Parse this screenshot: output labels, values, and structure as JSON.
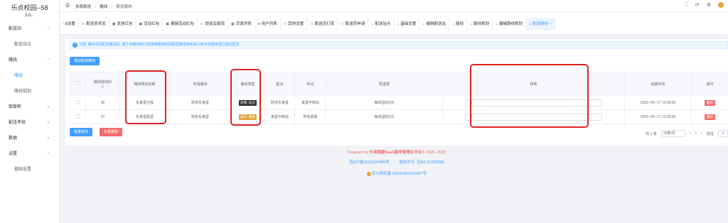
{
  "app": {
    "title": "乐点校园--58",
    "subtitle": "多段..."
  },
  "sidebar": {
    "items": [
      {
        "label": "配送站",
        "arrow": "^"
      },
      {
        "label": "配送站点"
      },
      {
        "label": "路线",
        "arrow": "^"
      },
      {
        "label": "路线"
      },
      {
        "label": "路线规划"
      },
      {
        "label": "取餐柜",
        "arrow": "v"
      },
      {
        "label": "配送考核",
        "arrow": "v"
      },
      {
        "label": "数据",
        "arrow": "v"
      },
      {
        "label": "设置",
        "arrow": "^"
      },
      {
        "label": "基础设置"
      }
    ]
  },
  "topbar": {
    "fold_icon": "☰",
    "breadcrumb": [
      "多段配送",
      "路线",
      "配送路线"
    ],
    "sep": ">"
  },
  "tabs": [
    {
      "label": "8设置",
      "icon": "‹"
    },
    {
      "label": "配送员奖惩",
      "icon": "⚇"
    },
    {
      "label": "发放红包",
      "icon": "▣"
    },
    {
      "label": "活动红包",
      "icon": "▣"
    },
    {
      "label": "编辑活动红包",
      "icon": "▣"
    },
    {
      "label": "提成及提现",
      "icon": "⚇"
    },
    {
      "label": "页面列表",
      "icon": "▦"
    },
    {
      "label": "用户列表",
      "icon": "●"
    },
    {
      "label": "其他设置",
      "icon": "⚇"
    },
    {
      "label": "配送员打赏",
      "icon": "⚇"
    },
    {
      "label": "配送员申请",
      "icon": "⚇"
    },
    {
      "label": "配送站点",
      "icon": "⌂"
    },
    {
      "label": "基础设置",
      "icon": "⌂"
    },
    {
      "label": "编辑配送站",
      "icon": "⌂"
    },
    {
      "label": "路线",
      "icon": "⌂"
    },
    {
      "label": "路线规划",
      "icon": "⌂"
    },
    {
      "label": "编辑路线规划",
      "icon": "⌂"
    },
    {
      "label": "配送路线",
      "icon": "⌂",
      "active": true,
      "close": "×"
    }
  ],
  "notice": {
    "icon": "i",
    "text": "注意: 路线添加配送路线后, 属于该路线的订单将按照绑定的配送路线排序由小到大的顺序进行送达配送"
  },
  "buttons": {
    "add": "添加配送路线",
    "batch_edit": "批量修改",
    "batch_delete": "批量删除"
  },
  "table": {
    "headers": [
      "",
      "路线规划ID",
      "路线规划名称",
      "所属路线",
      "路线类型",
      "起点",
      "终点",
      "配送费",
      "排序",
      "创建时间",
      "操作"
    ],
    "header_sort": "◇",
    "rows": [
      {
        "id": "36",
        "name": "东食堂分拣",
        "route": "财贸东食堂",
        "type": "商圈--站点",
        "type_color": "dark",
        "start": "财贸东食堂",
        "end": "食堂中转站",
        "fee": "每单固定0元",
        "sort": "1",
        "created": "2023--05--17 11:26:09",
        "action": "删除"
      },
      {
        "id": "37",
        "name": "东食堂配送",
        "route": "财贸东食堂",
        "type": "站点--楼栋",
        "type_color": "orange",
        "start": "食堂中转站",
        "end": "所有顾客",
        "fee": "每单固定0元",
        "sort": "2",
        "created": "2023--05--17 11:26:06",
        "action": "删除"
      }
    ]
  },
  "pager": {
    "total": "共 2 条",
    "size": "20条/页",
    "prev": "‹",
    "page": "1",
    "next": "›",
    "goto": "前往",
    "goto_val": "1"
  },
  "footer": {
    "line1_prefix": "Powered by ",
    "line1_brand": "外卖跑腿SaaS服务管理云平台",
    "line1_suffix": "© 2020--2022",
    "icp": "苏ICP备2022007489号",
    "license": "电信许可: 苏B2-20220556",
    "police": "苏公网安备 32030302001047号"
  },
  "colors": {
    "accent": "#409eff",
    "danger": "#f56c6c",
    "highlight": "#e02020"
  }
}
